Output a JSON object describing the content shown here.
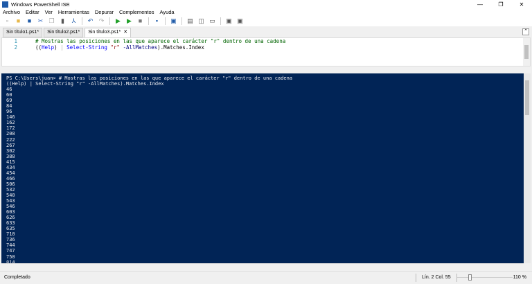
{
  "window": {
    "title": "Windows PowerShell ISE",
    "controls": [
      "—",
      "❐",
      "✕"
    ]
  },
  "menu": [
    "Archivo",
    "Editar",
    "Ver",
    "Herramientas",
    "Depurar",
    "Complementos",
    "Ayuda"
  ],
  "toolbar": [
    {
      "icon": "new-icon",
      "g": "▫",
      "c": "#888"
    },
    {
      "icon": "open-icon",
      "g": "■",
      "c": "#e8b84a"
    },
    {
      "icon": "save-icon",
      "g": "■",
      "c": "#1e5aa8"
    },
    {
      "icon": "cut-icon",
      "g": "✂",
      "c": "#3a6fc4"
    },
    {
      "icon": "copy-icon",
      "g": "❐",
      "c": "#aaa"
    },
    {
      "icon": "paste-icon",
      "g": "▮",
      "c": "#555"
    },
    {
      "icon": "clear-icon",
      "g": "⅄",
      "c": "#1e5aa8"
    },
    {
      "icon": "undo-icon",
      "g": "↶",
      "c": "#1e5aa8"
    },
    {
      "icon": "redo-icon",
      "g": "↷",
      "c": "#aaa"
    },
    {
      "icon": "run-icon",
      "g": "▶",
      "c": "#22a02a"
    },
    {
      "icon": "run-selection-icon",
      "g": "▶",
      "c": "#22a02a"
    },
    {
      "icon": "stop-icon",
      "g": "■",
      "c": "#777"
    },
    {
      "icon": "remote-icon",
      "g": "▪",
      "c": "#1e5aa8"
    },
    {
      "icon": "powershell-icon",
      "g": "▣",
      "c": "#1e5aa8"
    },
    {
      "icon": "layout-top-icon",
      "g": "▤",
      "c": "#555"
    },
    {
      "icon": "layout-right-icon",
      "g": "◫",
      "c": "#555"
    },
    {
      "icon": "layout-max-icon",
      "g": "▭",
      "c": "#555"
    },
    {
      "icon": "commands-icon",
      "g": "▣",
      "c": "#555"
    },
    {
      "icon": "addon-icon",
      "g": "▣",
      "c": "#555"
    }
  ],
  "tabs": [
    {
      "label": "Sin título1.ps1*"
    },
    {
      "label": "Sin título2.ps1*"
    },
    {
      "label": "Sin título3.ps1*",
      "active": true
    }
  ],
  "editor": {
    "line1": {
      "n": "1",
      "comment": "# Mostras las posiciones en las que aparece el carácter \"r\" dentro de una cadena"
    },
    "line2": {
      "n": "2",
      "p1": "((",
      "kw1": "Help",
      "p2": ")",
      "pipe": " | ",
      "kw2": "Select-String",
      "sp": " ",
      "str": "\"r\"",
      "sp2": " ",
      "param": "-AllMatches",
      "rest": ").Matches.Index"
    }
  },
  "console": {
    "lines": [
      "PS C:\\Users\\juan> # Mostras las posiciones en las que aparece el carácter \"r\" dentro de una cadena",
      "((Help) | Select-String \"r\" -AllMatches).Matches.Index",
      "46",
      "60",
      "69",
      "84",
      "96",
      "146",
      "162",
      "172",
      "208",
      "222",
      "267",
      "302",
      "388",
      "415",
      "434",
      "454",
      "466",
      "506",
      "532",
      "540",
      "543",
      "546",
      "603",
      "626",
      "633",
      "635",
      "710",
      "736",
      "744",
      "747",
      "750",
      "814"
    ]
  },
  "status": {
    "text": "Completado",
    "position": "Lín. 2  Col. 55",
    "zoom": "110 %",
    "zoom_percent": 110
  }
}
